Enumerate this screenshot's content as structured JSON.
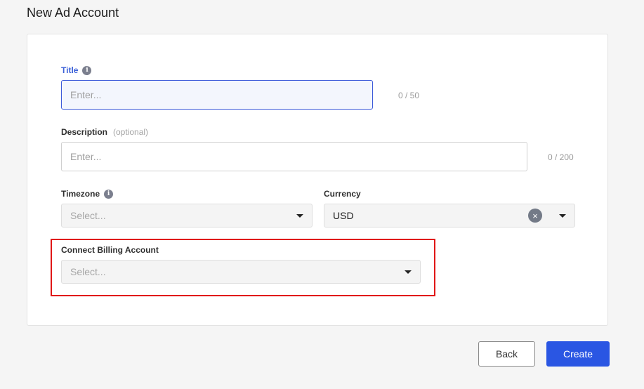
{
  "page": {
    "title": "New Ad Account"
  },
  "form": {
    "title": {
      "label": "Title",
      "placeholder": "Enter...",
      "value": "",
      "counter": "0 / 50"
    },
    "description": {
      "label": "Description",
      "optional": "(optional)",
      "placeholder": "Enter...",
      "value": "",
      "counter": "0 / 200"
    },
    "timezone": {
      "label": "Timezone",
      "placeholder": "Select..."
    },
    "currency": {
      "label": "Currency",
      "value": "USD"
    },
    "billing": {
      "label": "Connect Billing Account",
      "placeholder": "Select..."
    }
  },
  "icons": {
    "info": "i",
    "clear": "×"
  },
  "actions": {
    "back": "Back",
    "create": "Create"
  },
  "colors": {
    "primary": "#2a56e3",
    "highlight": "#e01616",
    "label_active": "#3d62d8"
  }
}
